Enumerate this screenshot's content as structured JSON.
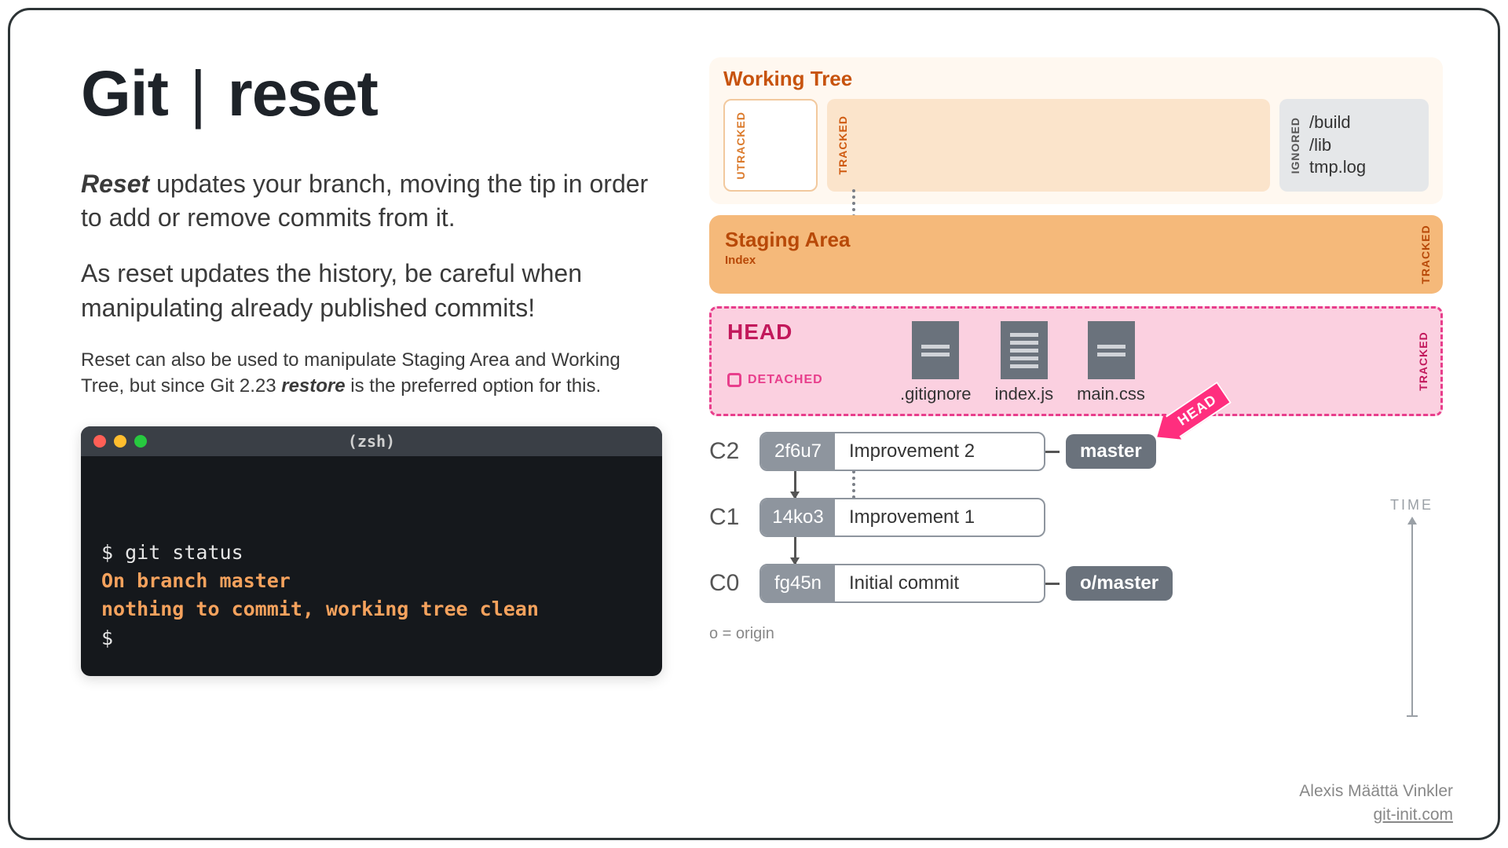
{
  "title": {
    "left": "Git",
    "right": "reset"
  },
  "para1": {
    "bold": "Reset",
    "rest": " updates your branch, moving the tip in order to add or remove commits from it."
  },
  "para2": "As reset updates the history, be careful when manipulating already published commits!",
  "para3": {
    "pre": "Reset can also be used to manipulate Staging Area and Working Tree, but since Git 2.23 ",
    "bold": "restore",
    "post": " is the preferred option for this."
  },
  "terminal": {
    "title": "(zsh)",
    "lines": [
      {
        "cls": "tc-cmd",
        "text": "$ git status"
      },
      {
        "cls": "tc-orange",
        "text": "On branch master"
      },
      {
        "cls": "tc-orange",
        "text": "nothing to commit, working tree clean"
      },
      {
        "cls": "tc-cmd",
        "text": "$ "
      }
    ]
  },
  "workingTree": {
    "title": "Working Tree",
    "utracked": "UTRACKED",
    "tracked": "TRACKED",
    "ignoredLabel": "IGNORED",
    "ignored": [
      "/build",
      "/lib",
      "tmp.log"
    ]
  },
  "staging": {
    "title": "Staging Area",
    "sub": "Index",
    "tracked": "TRACKED"
  },
  "head": {
    "title": "HEAD",
    "detached": "DETACHED",
    "tracked": "TRACKED",
    "files": [
      ".gitignore",
      "index.js",
      "main.css"
    ],
    "arrow": "HEAD"
  },
  "commits": [
    {
      "label": "C2",
      "hash": "2f6u7",
      "msg": "Improvement 2",
      "branch": "master"
    },
    {
      "label": "C1",
      "hash": "14ko3",
      "msg": "Improvement 1"
    },
    {
      "label": "C0",
      "hash": "fg45n",
      "msg": "Initial commit",
      "branch": "o/master"
    }
  ],
  "originNote": "o = origin",
  "timeLabel": "TIME",
  "credit": {
    "author": "Alexis Määttä Vinkler",
    "site": "git-init.com"
  }
}
